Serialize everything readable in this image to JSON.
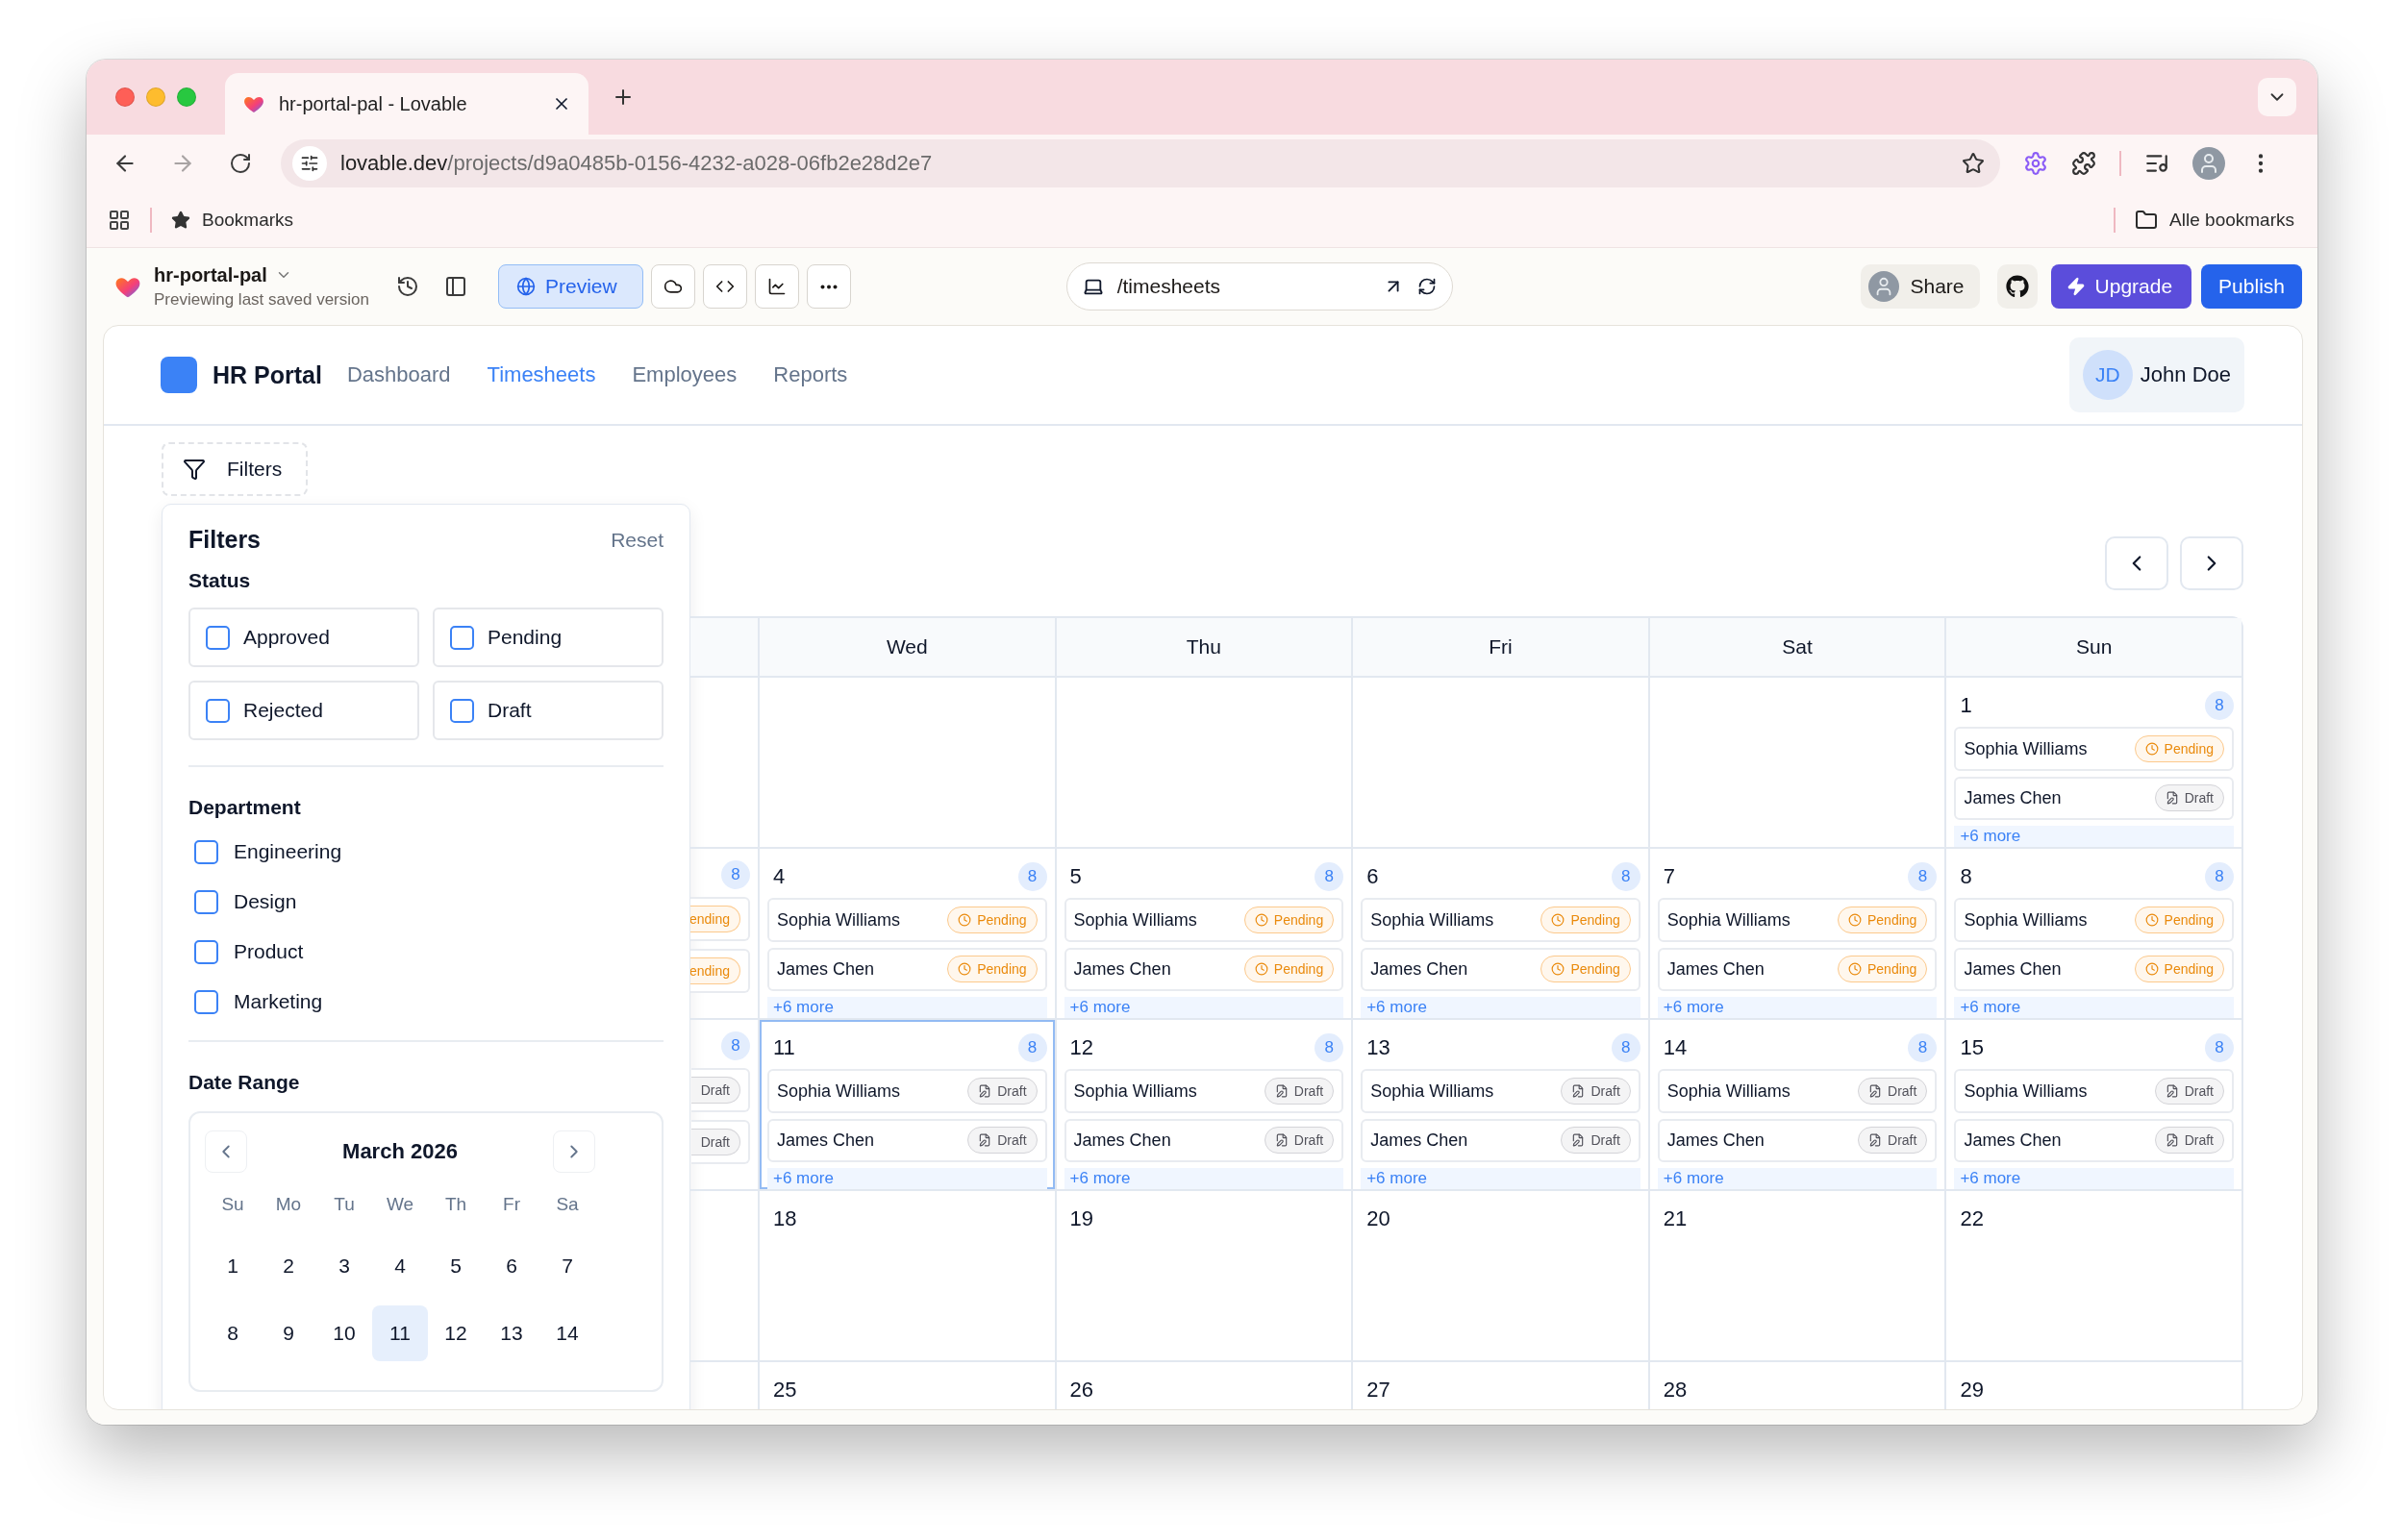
{
  "browser": {
    "tab_title": "hr-portal-pal - Lovable",
    "url_host": "lovable.dev",
    "url_path": "/projects/d9a0485b-0156-4232-a028-06fb2e28d2e7",
    "bookmarks": "Bookmarks",
    "all_bookmarks": "Alle bookmarks"
  },
  "editor_bar": {
    "project": "hr-portal-pal",
    "subtitle": "Previewing last saved version",
    "modes": [
      {
        "kind": "preview",
        "label": "Preview",
        "selected": true
      },
      {
        "kind": "cloud",
        "selected": false
      },
      {
        "kind": "code",
        "selected": false
      },
      {
        "kind": "analytics",
        "selected": false
      },
      {
        "kind": "more",
        "selected": false
      }
    ],
    "route": "/timesheets",
    "share": "Share",
    "upgrade": "Upgrade",
    "publish": "Publish"
  },
  "app": {
    "brand": "HR Portal",
    "nav": [
      {
        "label": "Dashboard",
        "selected": false
      },
      {
        "label": "Timesheets",
        "selected": true
      },
      {
        "label": "Employees",
        "selected": false
      },
      {
        "label": "Reports",
        "selected": false
      }
    ],
    "user": {
      "initials": "JD",
      "name": "John Doe"
    }
  },
  "filters": {
    "button": "Filters",
    "title": "Filters",
    "reset": "Reset",
    "status_heading": "Status",
    "statuses": [
      {
        "label": "Approved",
        "checked": false
      },
      {
        "label": "Pending",
        "checked": false
      },
      {
        "label": "Rejected",
        "checked": false
      },
      {
        "label": "Draft",
        "checked": false
      }
    ],
    "department_heading": "Department",
    "departments": [
      {
        "label": "Engineering",
        "checked": false
      },
      {
        "label": "Design",
        "checked": false
      },
      {
        "label": "Product",
        "checked": false
      },
      {
        "label": "Marketing",
        "checked": false
      }
    ],
    "date_heading": "Date Range",
    "mini_calendar": {
      "month": "March 2026",
      "weekdays": [
        "Su",
        "Mo",
        "Tu",
        "We",
        "Th",
        "Fr",
        "Sa"
      ],
      "weeks": [
        [
          {
            "day": "1",
            "selected": false
          },
          {
            "day": "2",
            "selected": false
          },
          {
            "day": "3",
            "selected": false
          },
          {
            "day": "4",
            "selected": false
          },
          {
            "day": "5",
            "selected": false
          },
          {
            "day": "6",
            "selected": false
          },
          {
            "day": "7",
            "selected": false
          }
        ],
        [
          {
            "day": "8",
            "selected": false
          },
          {
            "day": "9",
            "selected": false
          },
          {
            "day": "10",
            "selected": false
          },
          {
            "day": "11",
            "selected": true
          },
          {
            "day": "12",
            "selected": false
          },
          {
            "day": "13",
            "selected": false
          },
          {
            "day": "14",
            "selected": false
          }
        ]
      ]
    }
  },
  "calendar": {
    "weekdays": [
      {
        "label": "Wed"
      },
      {
        "label": "Thu"
      },
      {
        "label": "Fri"
      },
      {
        "label": "Sat"
      },
      {
        "label": "Sun"
      }
    ],
    "weeks": [
      {
        "days": [
          {
            "kind": "blank"
          },
          {
            "kind": "blank"
          },
          {
            "kind": "blank"
          },
          {
            "kind": "blank"
          },
          {
            "kind": "day",
            "day": "1",
            "today": false,
            "count": "8",
            "entries": [
              {
                "name": "Sophia Williams",
                "kind": "pending",
                "label": "Pending"
              },
              {
                "name": "James Chen",
                "kind": "draft",
                "label": "Draft"
              }
            ],
            "more": "+6 more"
          }
        ]
      },
      {
        "cut": {
          "count": "8",
          "badges": [
            {
              "kind": "pending",
              "label": "ending"
            },
            {
              "kind": "pending",
              "label": "ending"
            }
          ]
        },
        "days": [
          {
            "kind": "day",
            "day": "4",
            "today": false,
            "count": "8",
            "entries": [
              {
                "name": "Sophia Williams",
                "kind": "pending",
                "label": "Pending"
              },
              {
                "name": "James Chen",
                "kind": "pending",
                "label": "Pending"
              }
            ],
            "more": "+6 more"
          },
          {
            "kind": "day",
            "day": "5",
            "today": false,
            "count": "8",
            "entries": [
              {
                "name": "Sophia Williams",
                "kind": "pending",
                "label": "Pending"
              },
              {
                "name": "James Chen",
                "kind": "pending",
                "label": "Pending"
              }
            ],
            "more": "+6 more"
          },
          {
            "kind": "day",
            "day": "6",
            "today": false,
            "count": "8",
            "entries": [
              {
                "name": "Sophia Williams",
                "kind": "pending",
                "label": "Pending"
              },
              {
                "name": "James Chen",
                "kind": "pending",
                "label": "Pending"
              }
            ],
            "more": "+6 more"
          },
          {
            "kind": "day",
            "day": "7",
            "today": false,
            "count": "8",
            "entries": [
              {
                "name": "Sophia Williams",
                "kind": "pending",
                "label": "Pending"
              },
              {
                "name": "James Chen",
                "kind": "pending",
                "label": "Pending"
              }
            ],
            "more": "+6 more"
          },
          {
            "kind": "day",
            "day": "8",
            "today": false,
            "count": "8",
            "entries": [
              {
                "name": "Sophia Williams",
                "kind": "pending",
                "label": "Pending"
              },
              {
                "name": "James Chen",
                "kind": "pending",
                "label": "Pending"
              }
            ],
            "more": "+6 more"
          }
        ]
      },
      {
        "cut": {
          "count": "8",
          "badges": [
            {
              "kind": "draft",
              "label": "Draft"
            },
            {
              "kind": "draft",
              "label": "Draft"
            }
          ]
        },
        "days": [
          {
            "kind": "day",
            "day": "11",
            "today": true,
            "count": "8",
            "entries": [
              {
                "name": "Sophia Williams",
                "kind": "draft",
                "label": "Draft"
              },
              {
                "name": "James Chen",
                "kind": "draft",
                "label": "Draft"
              }
            ],
            "more": "+6 more"
          },
          {
            "kind": "day",
            "day": "12",
            "today": false,
            "count": "8",
            "entries": [
              {
                "name": "Sophia Williams",
                "kind": "draft",
                "label": "Draft"
              },
              {
                "name": "James Chen",
                "kind": "draft",
                "label": "Draft"
              }
            ],
            "more": "+6 more"
          },
          {
            "kind": "day",
            "day": "13",
            "today": false,
            "count": "8",
            "entries": [
              {
                "name": "Sophia Williams",
                "kind": "draft",
                "label": "Draft"
              },
              {
                "name": "James Chen",
                "kind": "draft",
                "label": "Draft"
              }
            ],
            "more": "+6 more"
          },
          {
            "kind": "day",
            "day": "14",
            "today": false,
            "count": "8",
            "entries": [
              {
                "name": "Sophia Williams",
                "kind": "draft",
                "label": "Draft"
              },
              {
                "name": "James Chen",
                "kind": "draft",
                "label": "Draft"
              }
            ],
            "more": "+6 more"
          },
          {
            "kind": "day",
            "day": "15",
            "today": false,
            "count": "8",
            "entries": [
              {
                "name": "Sophia Williams",
                "kind": "draft",
                "label": "Draft"
              },
              {
                "name": "James Chen",
                "kind": "draft",
                "label": "Draft"
              }
            ],
            "more": "+6 more"
          }
        ]
      },
      {
        "days": [
          {
            "kind": "day",
            "day": "18",
            "today": false
          },
          {
            "kind": "day",
            "day": "19",
            "today": false
          },
          {
            "kind": "day",
            "day": "20",
            "today": false
          },
          {
            "kind": "day",
            "day": "21",
            "today": false
          },
          {
            "kind": "day",
            "day": "22",
            "today": false
          }
        ]
      },
      {
        "days": [
          {
            "kind": "day",
            "day": "25",
            "today": false
          },
          {
            "kind": "day",
            "day": "26",
            "today": false
          },
          {
            "kind": "day",
            "day": "27",
            "today": false
          },
          {
            "kind": "day",
            "day": "28",
            "today": false
          },
          {
            "kind": "day",
            "day": "29",
            "today": false
          }
        ]
      }
    ]
  }
}
